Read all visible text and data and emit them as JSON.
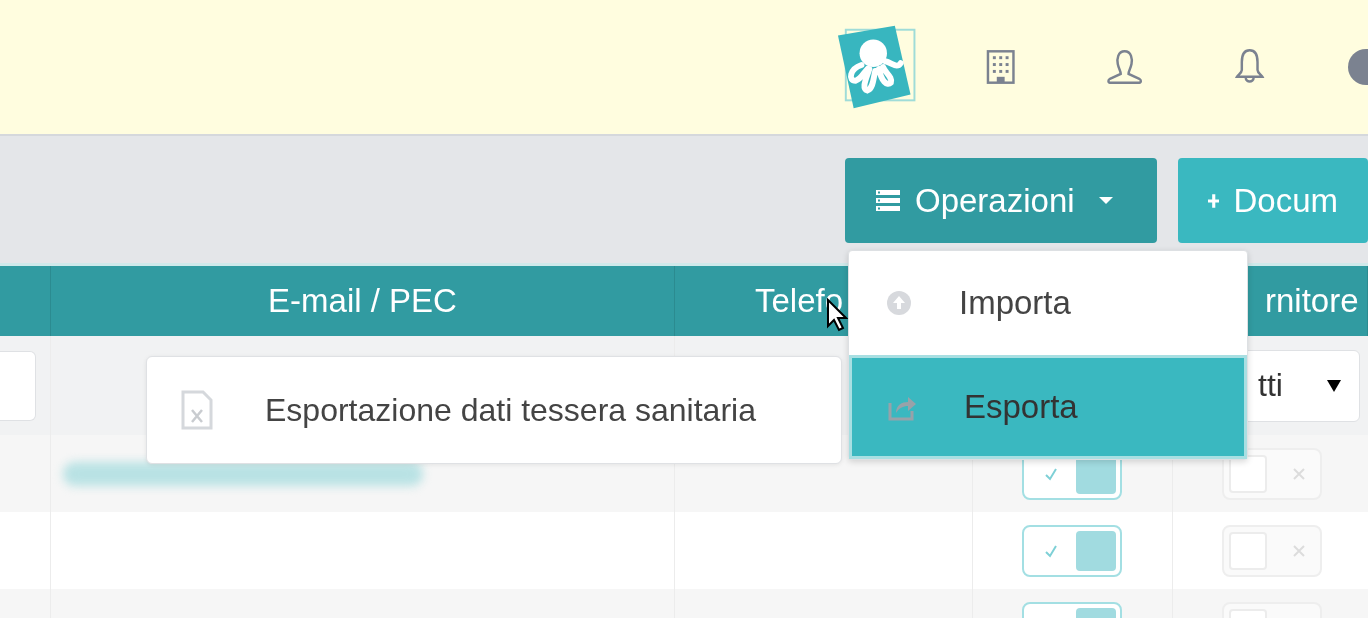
{
  "toolbar": {
    "buttons": [
      {
        "kind": "dropdown",
        "label": "Operazioni",
        "expanded": true
      },
      {
        "kind": "add",
        "label": "Docum"
      }
    ]
  },
  "operations_menu": {
    "items": [
      {
        "label": "Importa",
        "selected": false
      },
      {
        "label": "Esporta",
        "selected": true
      }
    ]
  },
  "export_submenu": {
    "items": [
      {
        "label": "Esportazione dati tessera sanitaria"
      }
    ]
  },
  "table": {
    "columns": [
      {},
      {
        "label": "E-mail / PEC"
      },
      {
        "label": "Telefo"
      },
      {},
      {
        "label": "rnitore"
      }
    ],
    "filters": {
      "column_1": {
        "kind": "text"
      },
      "column_5": {
        "kind": "select",
        "value": "tti"
      }
    },
    "rows": [
      {
        "email_redacted": true,
        "column_4": true,
        "column_5": false
      },
      {
        "email_redacted": false,
        "column_4": true,
        "column_5": false
      },
      {
        "email_redacted": false,
        "column_4": true,
        "column_5": false
      }
    ]
  }
}
